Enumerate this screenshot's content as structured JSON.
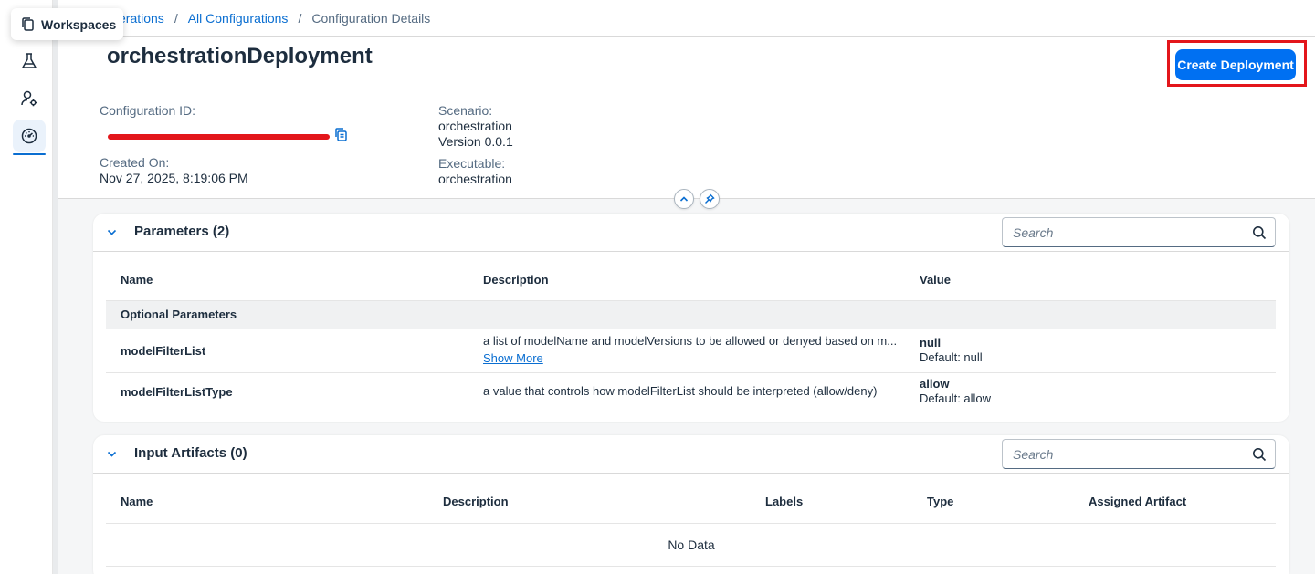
{
  "nav": {
    "tooltip": "Workspaces",
    "items": [
      {
        "icon": "lab-flask-icon",
        "label": "Lab"
      },
      {
        "icon": "user-settings-icon",
        "label": "Administration"
      },
      {
        "icon": "speedometer-icon",
        "label": "Operations"
      }
    ]
  },
  "breadcrumb": {
    "item1": "erations",
    "item2": "All Configurations",
    "current": "Configuration Details",
    "separator": "/"
  },
  "header": {
    "title": "orchestrationDeployment",
    "create_button": "Create Deployment",
    "config_id_label": "Configuration ID:",
    "created_on_label": "Created On:",
    "created_on_value": "Nov 27, 2025, 8:19:06 PM",
    "scenario_label": "Scenario:",
    "scenario_value": "orchestration",
    "version_value": "Version 0.0.1",
    "executable_label": "Executable:",
    "executable_value": "orchestration"
  },
  "parameters": {
    "title": "Parameters (2)",
    "search_placeholder": "Search",
    "columns": {
      "name": "Name",
      "description": "Description",
      "value": "Value"
    },
    "group_label": "Optional Parameters",
    "rows": [
      {
        "name": "modelFilterList",
        "description": "a list of modelName and modelVersions to be allowed or denyed based on m...",
        "show_more": "Show More",
        "value": "null",
        "default": "Default: null"
      },
      {
        "name": "modelFilterListType",
        "description": "a value that controls how modelFilterList should be interpreted (allow/deny)",
        "value": "allow",
        "default": "Default: allow"
      }
    ]
  },
  "artifacts": {
    "title": "Input Artifacts (0)",
    "search_placeholder": "Search",
    "columns": {
      "name": "Name",
      "description": "Description",
      "labels": "Labels",
      "type": "Type",
      "assigned": "Assigned Artifact"
    },
    "empty_text": "No Data"
  },
  "colors": {
    "accent": "#0070f2",
    "link": "#0a6ed1",
    "highlight": "#e3161b"
  }
}
